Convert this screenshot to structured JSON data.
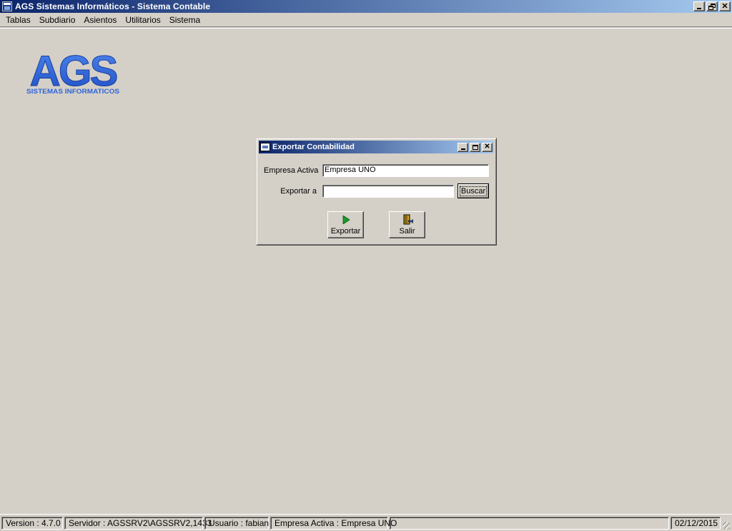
{
  "window": {
    "title": "AGS Sistemas Informáticos - Sistema Contable",
    "buttons": {
      "minimize": "_",
      "restore": "❐",
      "close": "✕"
    }
  },
  "menu": {
    "items": [
      "Tablas",
      "Subdiario",
      "Asientos",
      "Utilitarios",
      "Sistema"
    ]
  },
  "logo": {
    "name": "AGS",
    "tagline": "SISTEMAS INFORMATICOS",
    "color": "#2f63d8"
  },
  "dialog": {
    "title": "Exportar Contabilidad",
    "empresa_label": "Empresa Activa",
    "empresa_value": "Empresa UNO",
    "exportar_a_label": "Exportar a",
    "exportar_a_value": "",
    "buscar_label": "Buscar",
    "exportar_button": "Exportar",
    "salir_button": "Salir",
    "icons": {
      "exportar": "play-icon",
      "salir": "exit-door-icon"
    }
  },
  "statusbar": {
    "version": "Version : 4.7.0",
    "servidor": "Servidor : AGSSRV2\\AGSSRV2,1433",
    "usuario": "Usuario : fabian",
    "empresa": "Empresa Activa : Empresa UNO",
    "fecha": "02/12/2015"
  }
}
